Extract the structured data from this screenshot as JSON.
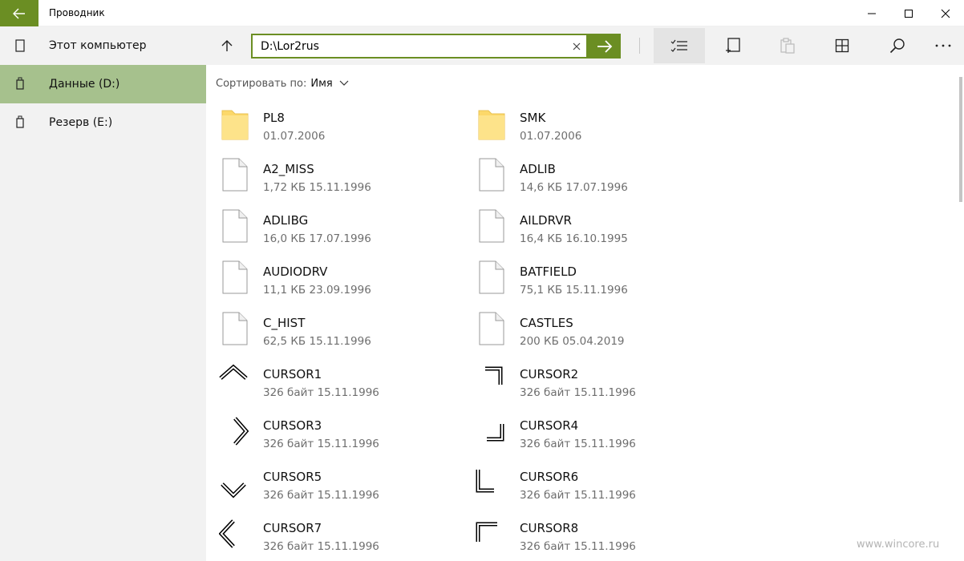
{
  "window": {
    "title": "Проводник"
  },
  "sidebar": {
    "items": [
      {
        "label": "Этот компьютер",
        "icon": "computer-icon",
        "selected": false
      },
      {
        "label": "Данные (D:)",
        "icon": "drive-icon",
        "selected": true
      },
      {
        "label": "Резерв (E:)",
        "icon": "drive-icon",
        "selected": false
      }
    ]
  },
  "toolbar": {
    "address_value": "D:\\Lor2rus",
    "icons": [
      "up-arrow-icon",
      "clear-icon",
      "go-arrow-icon",
      "select-list-icon",
      "new-item-icon",
      "paste-icon",
      "view-grid-icon",
      "search-icon",
      "more-icon"
    ]
  },
  "sort": {
    "prefix": "Сортировать по:",
    "value": "Имя"
  },
  "files": [
    {
      "name": "PL8",
      "meta": "01.07.2006",
      "icon": "folder-icon"
    },
    {
      "name": "SMK",
      "meta": "01.07.2006",
      "icon": "folder-icon"
    },
    {
      "name": "A2_MISS",
      "meta": "1,72 КБ 15.11.1996",
      "icon": "file-icon"
    },
    {
      "name": "ADLIB",
      "meta": "14,6 КБ 17.07.1996",
      "icon": "file-icon"
    },
    {
      "name": "ADLIBG",
      "meta": "16,0 КБ 17.07.1996",
      "icon": "file-icon"
    },
    {
      "name": "AILDRVR",
      "meta": "16,4 КБ 16.10.1995",
      "icon": "file-icon"
    },
    {
      "name": "AUDIODRV",
      "meta": "11,1 КБ 23.09.1996",
      "icon": "file-icon"
    },
    {
      "name": "BATFIELD",
      "meta": "75,1 КБ 15.11.1996",
      "icon": "file-icon"
    },
    {
      "name": "C_HIST",
      "meta": "62,5 КБ 15.11.1996",
      "icon": "file-icon"
    },
    {
      "name": "CASTLES",
      "meta": "200 КБ 05.04.2019",
      "icon": "file-icon"
    },
    {
      "name": "CURSOR1",
      "meta": "326 байт 15.11.1996",
      "icon": "cursor-up-icon"
    },
    {
      "name": "CURSOR2",
      "meta": "326 байт 15.11.1996",
      "icon": "cursor-topright-icon"
    },
    {
      "name": "CURSOR3",
      "meta": "326 байт 15.11.1996",
      "icon": "cursor-right-icon"
    },
    {
      "name": "CURSOR4",
      "meta": "326 байт 15.11.1996",
      "icon": "cursor-bottomright-icon"
    },
    {
      "name": "CURSOR5",
      "meta": "326 байт 15.11.1996",
      "icon": "cursor-down-icon"
    },
    {
      "name": "CURSOR6",
      "meta": "326 байт 15.11.1996",
      "icon": "cursor-bottomleft-icon"
    },
    {
      "name": "CURSOR7",
      "meta": "326 байт 15.11.1996",
      "icon": "cursor-left-icon"
    },
    {
      "name": "CURSOR8",
      "meta": "326 байт 15.11.1996",
      "icon": "cursor-topleft-icon"
    }
  ],
  "watermark": "www.wincore.ru",
  "colors": {
    "accent": "#6b8e23",
    "selected": "#a6c18d",
    "folder": "#fcd86a"
  }
}
